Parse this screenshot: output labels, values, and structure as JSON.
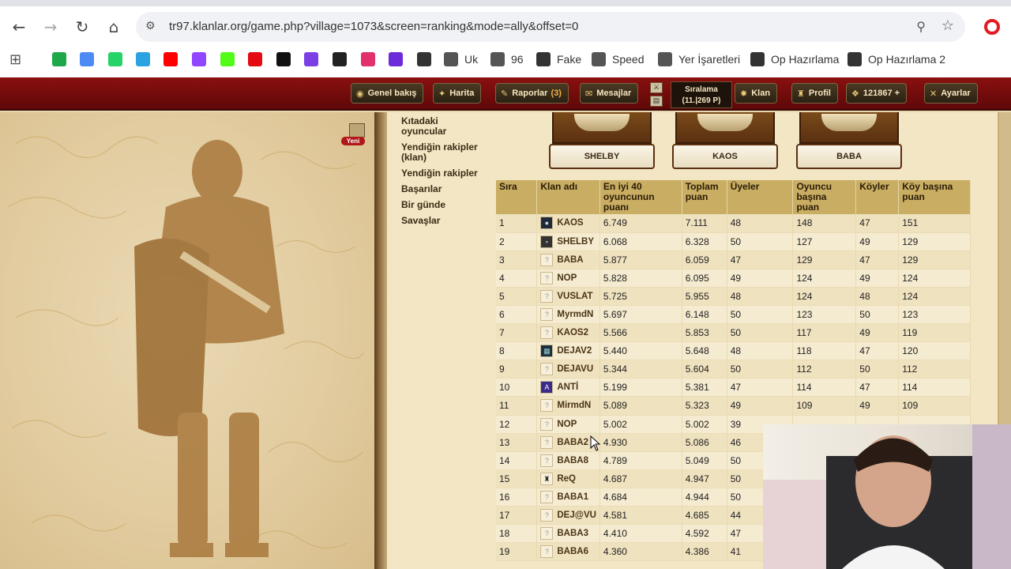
{
  "browser": {
    "url": "tr97.klanlar.org/game.php?village=1073&screen=ranking&mode=ally&offset=0",
    "bookmarks": [
      {
        "label": "",
        "color": "#1fa84a"
      },
      {
        "label": "",
        "color": "#4c8bf5"
      },
      {
        "label": "",
        "color": "#25d366"
      },
      {
        "label": "",
        "color": "#2aa3e0"
      },
      {
        "label": "",
        "color": "#ff0000"
      },
      {
        "label": "",
        "color": "#9146ff"
      },
      {
        "label": "",
        "color": "#53fc18"
      },
      {
        "label": "",
        "color": "#e50914"
      },
      {
        "label": "",
        "color": "#111111"
      },
      {
        "label": "",
        "color": "#7b3fe4"
      },
      {
        "label": "",
        "color": "#222222"
      },
      {
        "label": "",
        "color": "#e1306c"
      },
      {
        "label": "",
        "color": "#6c2bd9"
      },
      {
        "label": "",
        "color": "#333333"
      },
      {
        "label": "Uk",
        "color": "#555555"
      },
      {
        "label": "96",
        "color": "#555555"
      },
      {
        "label": "Fake",
        "color": "#333333"
      },
      {
        "label": "Speed",
        "color": "#555555"
      },
      {
        "label": "Yer İşaretleri",
        "color": "#555555"
      },
      {
        "label": "Op Hazırlama",
        "color": "#333333"
      },
      {
        "label": "Op Hazırlama 2",
        "color": "#333333"
      }
    ]
  },
  "gamebar": {
    "overview": "Genel bakış",
    "map": "Harita",
    "reports": "Raporlar",
    "reports_count": "(3)",
    "messages": "Mesajlar",
    "ranking_label": "Sıralama",
    "ranking_value": "(11.|269 P)",
    "clan": "Klan",
    "profile": "Profil",
    "points": "121867 +",
    "settings": "Ayarlar"
  },
  "art": {
    "new_badge": "Yeni"
  },
  "sidemenu": [
    "Kıtadaki oyuncular",
    "Yendiğin rakipler (klan)",
    "Yendiğin rakipler",
    "Başarılar",
    "Bir günde",
    "Savaşlar"
  ],
  "podium": [
    "SHELBY",
    "KAOS",
    "BABA"
  ],
  "table": {
    "headers": [
      "Sıra",
      "Klan adı",
      "En iyi 40 oyuncunun puanı",
      "Toplam puan",
      "Üyeler",
      "Oyuncu başına puan",
      "Köyler",
      "Köy başına puan"
    ],
    "rows": [
      [
        "1",
        "KAOS",
        "6.749",
        "7.111",
        "48",
        "148",
        "47",
        "151"
      ],
      [
        "2",
        "SHELBY",
        "6.068",
        "6.328",
        "50",
        "127",
        "49",
        "129"
      ],
      [
        "3",
        "BABA",
        "5.877",
        "6.059",
        "47",
        "129",
        "47",
        "129"
      ],
      [
        "4",
        "NOP",
        "5.828",
        "6.095",
        "49",
        "124",
        "49",
        "124"
      ],
      [
        "5",
        "VUSLAT",
        "5.725",
        "5.955",
        "48",
        "124",
        "48",
        "124"
      ],
      [
        "6",
        "MyrmdN",
        "5.697",
        "6.148",
        "50",
        "123",
        "50",
        "123"
      ],
      [
        "7",
        "KAOS2",
        "5.566",
        "5.853",
        "50",
        "117",
        "49",
        "119"
      ],
      [
        "8",
        "DEJAV2",
        "5.440",
        "5.648",
        "48",
        "118",
        "47",
        "120"
      ],
      [
        "9",
        "DEJAVU",
        "5.344",
        "5.604",
        "50",
        "112",
        "50",
        "112"
      ],
      [
        "10",
        "ANTİ",
        "5.199",
        "5.381",
        "47",
        "114",
        "47",
        "114"
      ],
      [
        "11",
        "MirmdN",
        "5.089",
        "5.323",
        "49",
        "109",
        "49",
        "109"
      ],
      [
        "12",
        "NOP",
        "5.002",
        "5.002",
        "39",
        "",
        "",
        ""
      ],
      [
        "13",
        "BABA2",
        "4.930",
        "5.086",
        "46",
        "",
        "",
        ""
      ],
      [
        "14",
        "BABA8",
        "4.789",
        "5.049",
        "50",
        "",
        "",
        ""
      ],
      [
        "15",
        "ReQ",
        "4.687",
        "4.947",
        "50",
        "",
        "",
        ""
      ],
      [
        "16",
        "BABA1",
        "4.684",
        "4.944",
        "50",
        "",
        "",
        ""
      ],
      [
        "17",
        "DEJ@VU",
        "4.581",
        "4.685",
        "44",
        "",
        "",
        ""
      ],
      [
        "18",
        "BABA3",
        "4.410",
        "4.592",
        "47",
        "",
        "",
        ""
      ],
      [
        "19",
        "BABA6",
        "4.360",
        "4.386",
        "41",
        "",
        "",
        ""
      ]
    ]
  }
}
